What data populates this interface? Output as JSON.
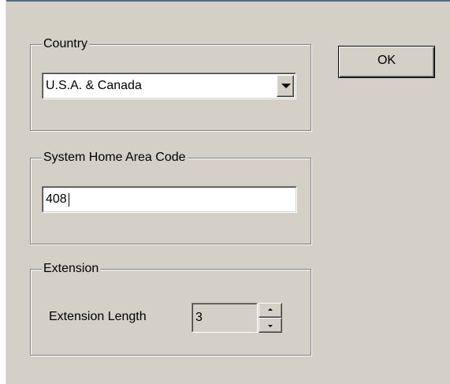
{
  "country": {
    "group_label": "Country",
    "selected_value": "U.S.A. & Canada"
  },
  "home_area_code": {
    "group_label": "System Home Area Code",
    "value": "408"
  },
  "extension": {
    "group_label": "Extension",
    "length_label": "Extension Length",
    "length_value": "3"
  },
  "buttons": {
    "ok_label": "OK"
  },
  "icons": {
    "dropdown": "chevron-down-icon",
    "spin_up": "spin-up-icon",
    "spin_down": "spin-down-icon"
  },
  "colors": {
    "dialog_background": "#d4d0c8",
    "field_background": "#ffffff",
    "disabled_field_background": "#d4d0c8"
  }
}
